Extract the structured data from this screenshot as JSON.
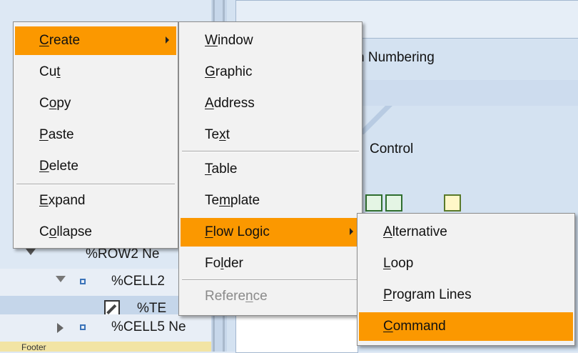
{
  "tree": {
    "rows": [
      {
        "text": "%ROW2 Ne"
      },
      {
        "text": "%CELL2"
      },
      {
        "text": "%TE"
      },
      {
        "text": "%CELL5 Ne"
      },
      {
        "text": "Footer"
      }
    ]
  },
  "main": {
    "numbering_text": "h Numbering",
    "control_text": "Control"
  },
  "menu1": {
    "items": [
      {
        "label": "Create",
        "mnemonic": "C",
        "rest": "reate"
      },
      {
        "label": "Cut",
        "mnemonic": "t",
        "pre": "Cu"
      },
      {
        "label": "Copy",
        "mnemonic": "o",
        "pre": "C",
        "rest": "py"
      },
      {
        "label": "Paste",
        "mnemonic": "P",
        "rest": "aste"
      },
      {
        "label": "Delete",
        "mnemonic": "D",
        "rest": "elete"
      },
      {
        "label": "Expand",
        "mnemonic": "E",
        "rest": "xpand"
      },
      {
        "label": "Collapse",
        "mnemonic": "o",
        "pre": "C",
        "rest": "llapse"
      }
    ]
  },
  "menu2": {
    "items": [
      {
        "label": "Window",
        "mnemonic": "W",
        "rest": "indow"
      },
      {
        "label": "Graphic",
        "mnemonic": "G",
        "rest": "raphic"
      },
      {
        "label": "Address",
        "mnemonic": "A",
        "rest": "ddress"
      },
      {
        "label": "Text",
        "mnemonic": "x",
        "pre": "Te",
        "rest": "t"
      },
      {
        "label": "Table",
        "mnemonic": "T",
        "rest": "able"
      },
      {
        "label": "Template",
        "mnemonic": "m",
        "pre": "Te",
        "rest": "plate"
      },
      {
        "label": "Flow Logic",
        "mnemonic": "F",
        "rest": "low Logic"
      },
      {
        "label": "Folder",
        "mnemonic": "l",
        "pre": "Fo",
        "rest": "der"
      },
      {
        "label": "Reference",
        "mnemonic": "n",
        "pre": "Refere",
        "rest": "ce"
      }
    ]
  },
  "menu3": {
    "items": [
      {
        "label": "Alternative",
        "mnemonic": "A",
        "rest": "lternative"
      },
      {
        "label": "Loop",
        "mnemonic": "L",
        "rest": "oop"
      },
      {
        "label": "Program Lines",
        "mnemonic": "P",
        "rest": "rogram Lines"
      },
      {
        "label": "Command",
        "mnemonic": "C",
        "rest": "ommand"
      }
    ]
  },
  "colors": {
    "highlight": "#fb9800",
    "menu_bg": "#f2f2f2",
    "disabled_text": "#8a8a8a"
  },
  "icons": {
    "submenu": "chevron-right-icon",
    "expand": "triangle-down-icon",
    "collapse": "triangle-right-icon",
    "node": "square-node-icon",
    "edit": "edit-icon"
  }
}
